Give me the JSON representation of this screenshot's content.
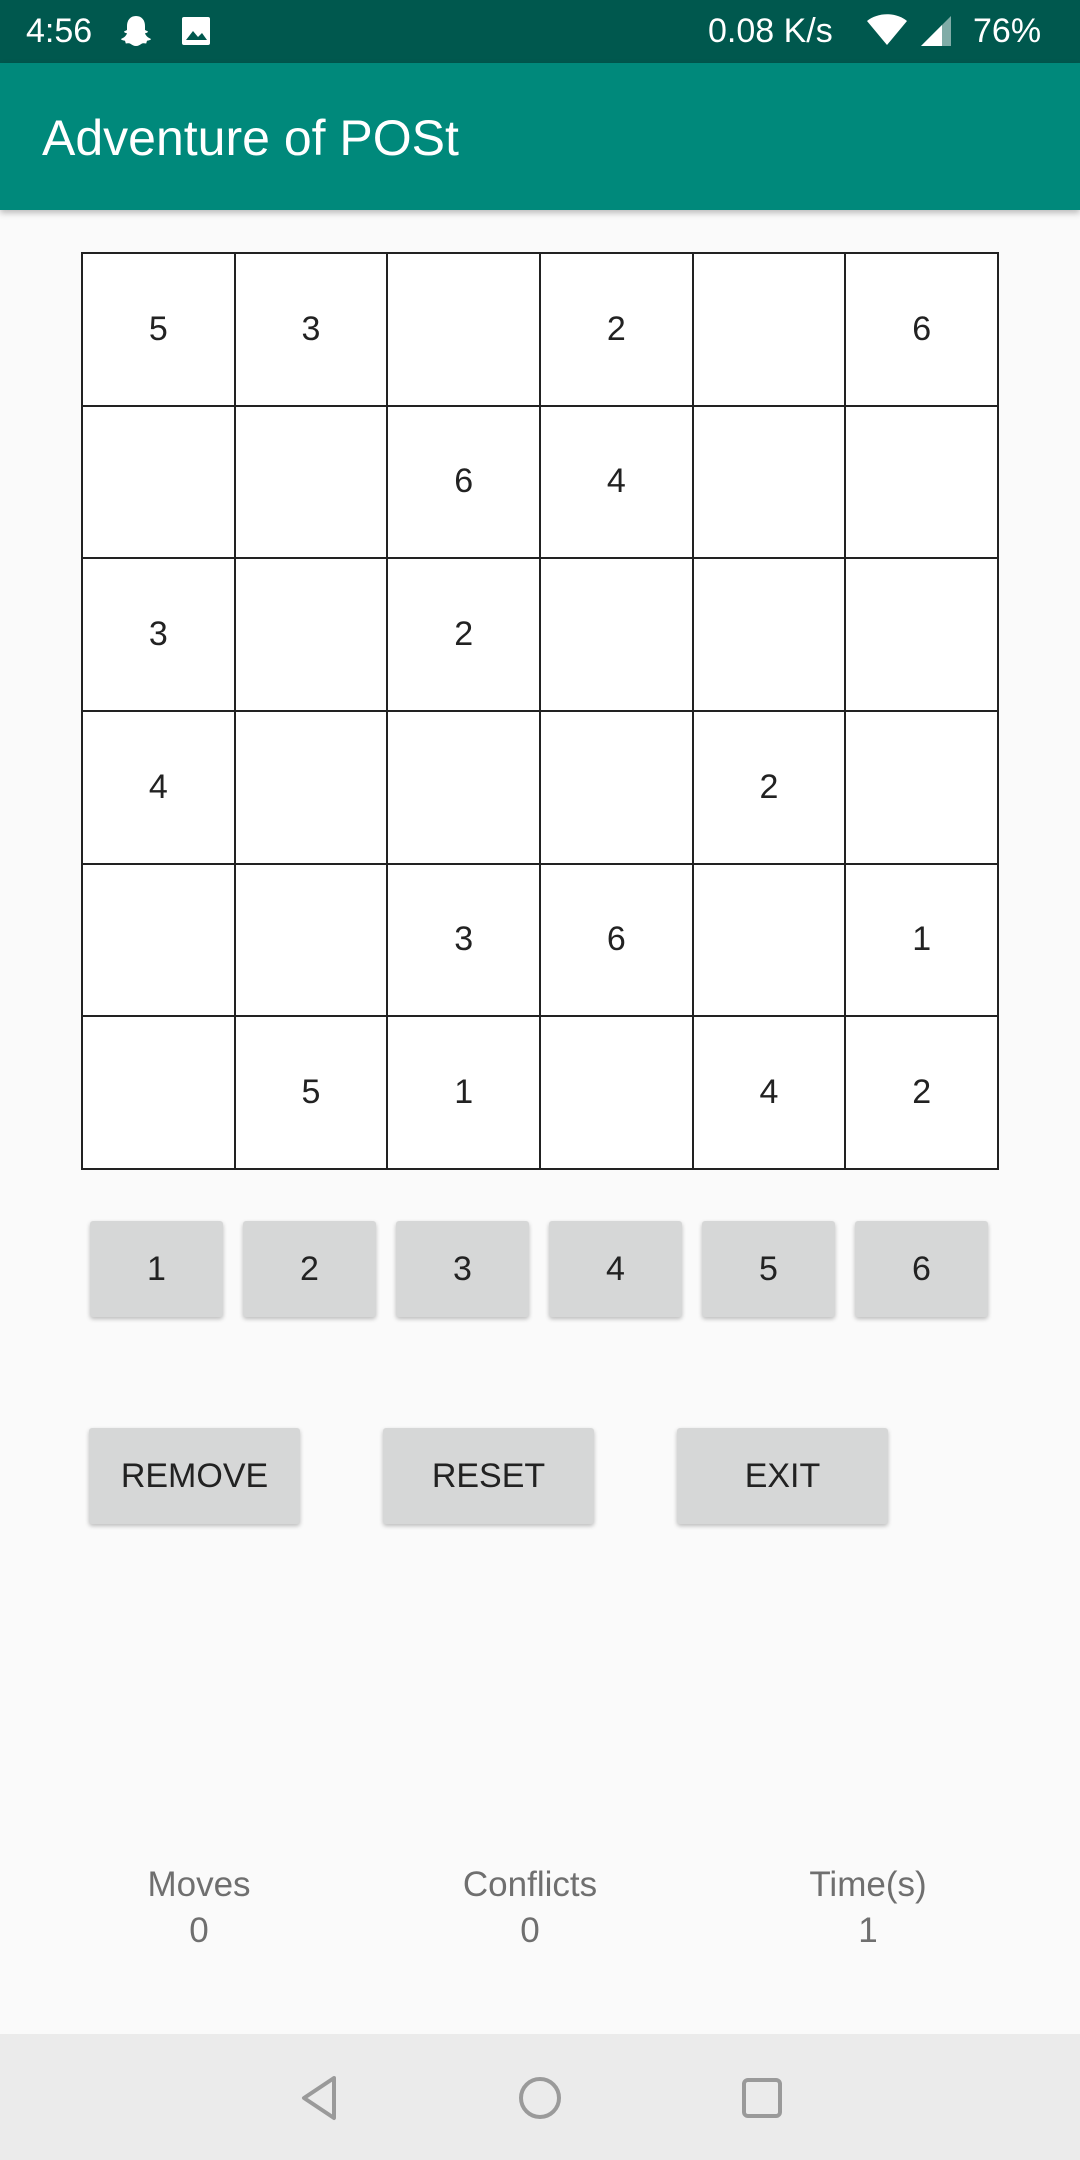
{
  "status_bar": {
    "time": "4:56",
    "network_speed": "0.08 K/s",
    "battery": "76%",
    "icons": [
      "snapchat-ghost-icon",
      "image-icon",
      "wifi-icon",
      "signal-icon"
    ]
  },
  "app_bar": {
    "title": "Adventure of POSt",
    "color": "#00897b"
  },
  "board": {
    "rows": [
      [
        "5",
        "3",
        "",
        "2",
        "",
        "6"
      ],
      [
        "",
        "",
        "6",
        "4",
        "",
        ""
      ],
      [
        "3",
        "",
        "2",
        "",
        "",
        ""
      ],
      [
        "4",
        "",
        "",
        "",
        "2",
        ""
      ],
      [
        "",
        "",
        "3",
        "6",
        "",
        "1"
      ],
      [
        "",
        "5",
        "1",
        "",
        "4",
        "2"
      ]
    ]
  },
  "number_buttons": [
    "1",
    "2",
    "3",
    "4",
    "5",
    "6"
  ],
  "actions": {
    "remove": "REMOVE",
    "reset": "RESET",
    "exit": "EXIT"
  },
  "stats": {
    "moves_label": "Moves",
    "moves_value": "0",
    "conflicts_label": "Conflicts",
    "conflicts_value": "0",
    "time_label": "Time(s)",
    "time_value": "1"
  },
  "nav_bar": {
    "icons": [
      "back-icon",
      "home-icon",
      "recents-icon"
    ]
  }
}
